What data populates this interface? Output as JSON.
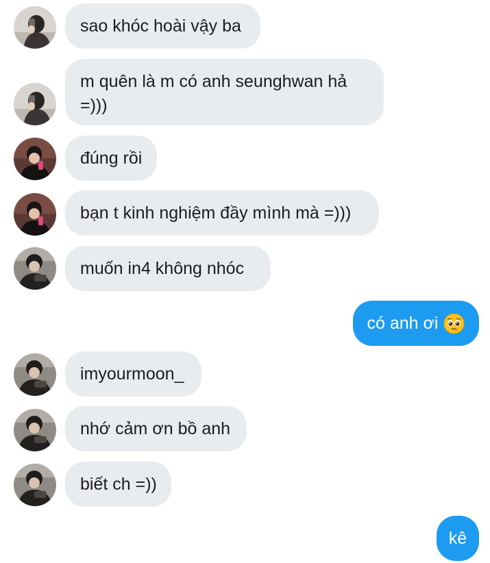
{
  "messages": [
    {
      "side": "in",
      "avatar": "avatar-1",
      "text": "sao khóc hoài vậy ba"
    },
    {
      "side": "in",
      "avatar": "avatar-1",
      "text": "m quên là m có anh seunghwan hả =)))"
    },
    {
      "side": "in",
      "avatar": "avatar-2",
      "text": "đúng rồi"
    },
    {
      "side": "in",
      "avatar": "avatar-2",
      "text": "bạn t kinh nghiệm đầy mình mà =)))"
    },
    {
      "side": "in",
      "avatar": "avatar-3",
      "text": "muốn in4 không nhóc"
    },
    {
      "side": "out",
      "text": "có anh ơi",
      "emoji": "pleading-face-icon"
    },
    {
      "side": "in",
      "avatar": "avatar-3",
      "text": "imyourmoon_"
    },
    {
      "side": "in",
      "avatar": "avatar-3",
      "text": "nhớ cảm ơn bồ anh"
    },
    {
      "side": "in",
      "avatar": "avatar-3",
      "text": "biết ch =))"
    },
    {
      "side": "out",
      "text": "kê"
    }
  ],
  "colors": {
    "incoming_bubble": "#e9ecef",
    "outgoing_bubble": "#1d9bf0",
    "incoming_text": "#1c1c1c",
    "outgoing_text": "#ffffff"
  }
}
